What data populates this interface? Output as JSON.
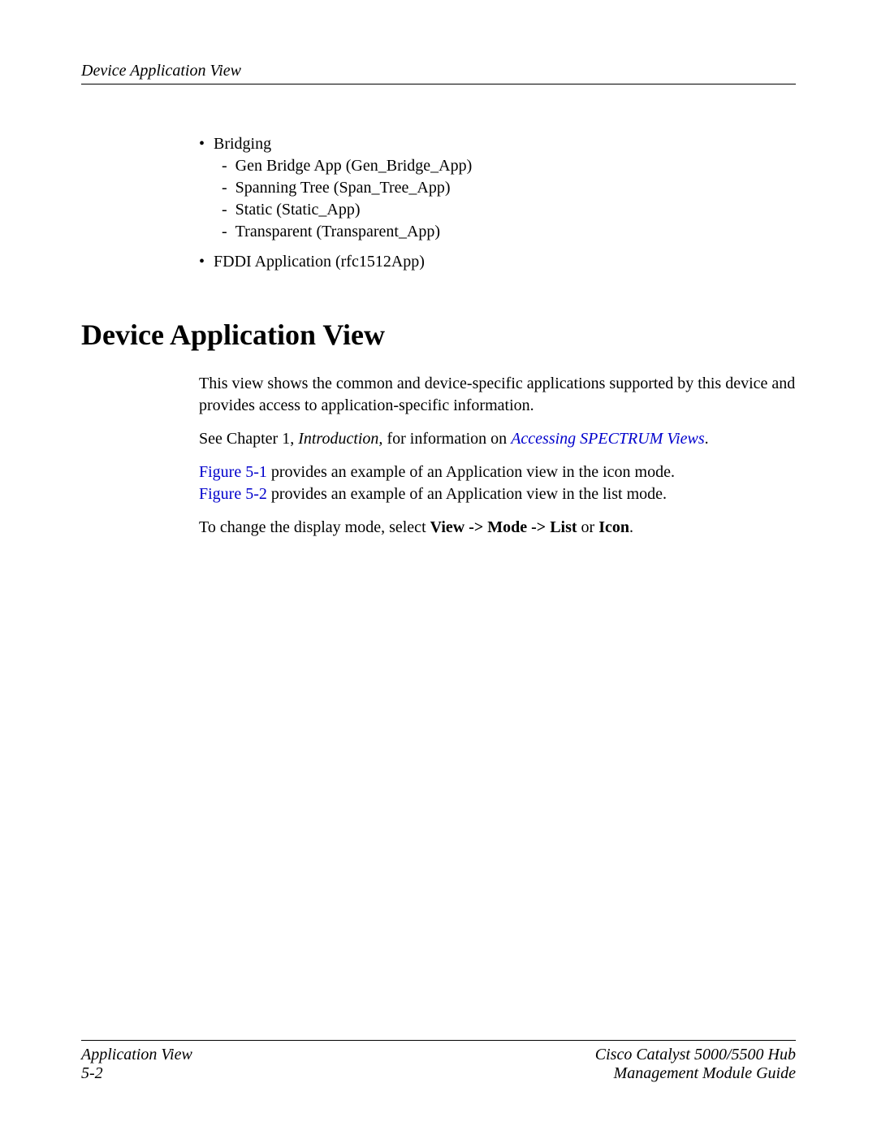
{
  "header": {
    "title": "Device Application View"
  },
  "list": {
    "bridging": {
      "label": "Bridging",
      "items": [
        "Gen Bridge App (Gen_Bridge_App)",
        "Spanning Tree (Span_Tree_App)",
        "Static (Static_App)",
        "Transparent (Transparent_App)"
      ]
    },
    "fddi": "FDDI Application (rfc1512App)"
  },
  "section": {
    "heading": "Device Application View",
    "para1": "This view shows the common and device-specific applications supported by this device and provides access to application-specific information.",
    "see_prefix": "See Chapter 1, ",
    "see_intro": "Introduction,",
    "see_mid": " for information on ",
    "see_link": "Accessing SPECTRUM Views",
    "see_suffix": ".",
    "fig1_link": "Figure 5-1",
    "fig1_rest": " provides an example of an Application view in the icon mode.",
    "fig2_link": "Figure 5-2",
    "fig2_rest": " provides an example of an Application view in the list mode.",
    "mode_prefix": "To change the display mode, select ",
    "mode_bold1": "View -> Mode -> List",
    "mode_mid": " or ",
    "mode_bold2": "Icon",
    "mode_suffix": "."
  },
  "footer": {
    "left1": "Application View",
    "left2": "5-2",
    "right1": "Cisco Catalyst 5000/5500 Hub",
    "right2": "Management Module Guide"
  }
}
